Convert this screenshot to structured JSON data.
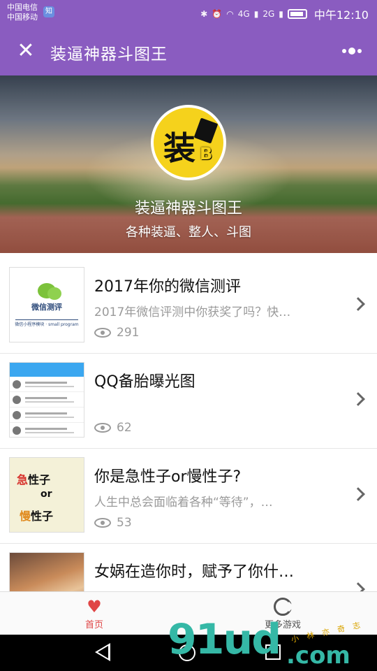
{
  "status_bar": {
    "carrier1": "中国电信",
    "carrier2": "中国移动",
    "badge": "知",
    "network1": "4G",
    "network2": "2G",
    "time": "中午12:10"
  },
  "header": {
    "title": "装逼神器斗图王"
  },
  "hero": {
    "app_name": "装逼神器斗图王",
    "description": "各种装逼、整人、斗图",
    "logo_text": "装",
    "logo_letter": "B"
  },
  "list": [
    {
      "title": "2017年你的微信测评",
      "description": "2017年微信评测中你获奖了吗？快…",
      "views": "291",
      "thumb_text": "微信测评",
      "thumb_sub": "微信小程序模块 · small program"
    },
    {
      "title": "QQ备胎曝光图",
      "description": "",
      "views": "62"
    },
    {
      "title": "你是急性子or慢性子?",
      "description": "人生中总会面临着各种“等待”，…",
      "views": "53",
      "thumb_line1_accent": "急",
      "thumb_line1_rest": "性子",
      "thumb_or": "or",
      "thumb_line3_accent": "慢",
      "thumb_line3_rest": "性子"
    },
    {
      "title": "女娲在造你时，赋予了你什…",
      "description": "",
      "views": ""
    }
  ],
  "bottom_nav": {
    "home_label": "首页",
    "games_label": "更多游戏"
  },
  "watermark": {
    "main": "91ud",
    "com": ".com",
    "small": "小 林 亦 奇 志"
  },
  "colors": {
    "header_bg": "#8a5cc0",
    "accent_red": "#e04545"
  }
}
